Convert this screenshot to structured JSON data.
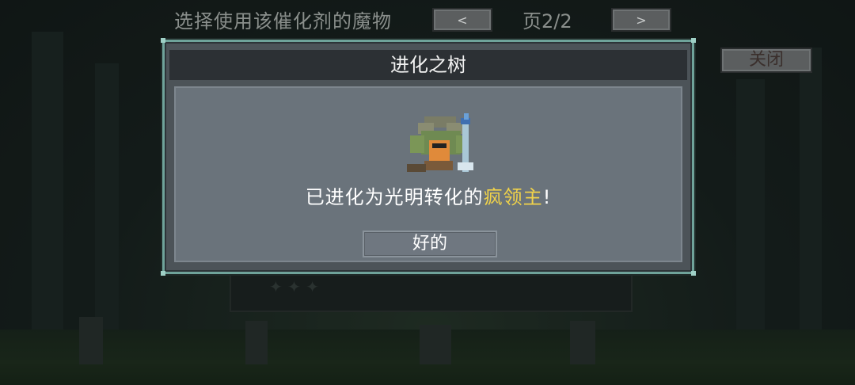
{
  "header": {
    "title": "选择使用该催化剂的魔物",
    "prev_label": "<",
    "page_label": "页2/2",
    "next_label": ">",
    "close_label": "关闭"
  },
  "dialog": {
    "title": "进化之树",
    "message_prefix": "已进化为光明转化的",
    "monster_name": "疯领主",
    "message_suffix": "!",
    "ok_label": "好的"
  },
  "colors": {
    "dialog_border": "#6fa39a",
    "highlight": "#f0d24a",
    "panel": "#6a737b"
  }
}
